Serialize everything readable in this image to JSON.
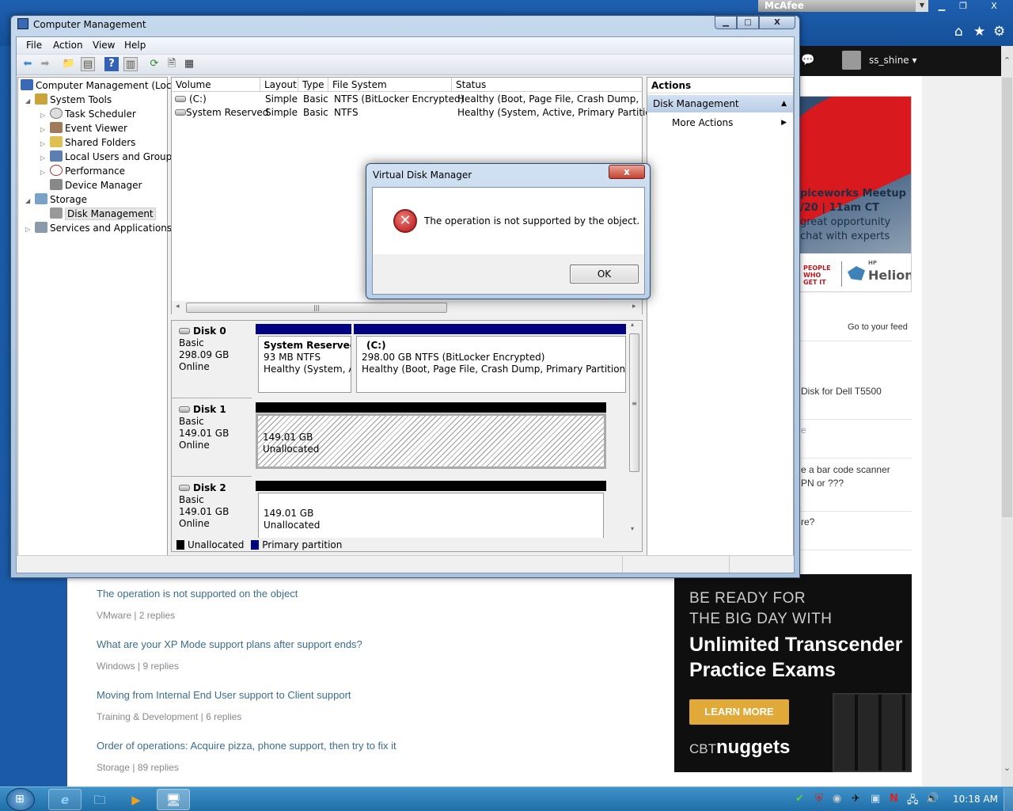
{
  "browser": {
    "security_addon": "McAfee",
    "nav_icons": [
      "home-icon",
      "star-icon",
      "gear-icon"
    ],
    "username": "ss_shine"
  },
  "site": {
    "ad1": {
      "lines": [
        "piceworks Meetup",
        "/20 | 11am CT",
        "great opportunity",
        "chat with experts"
      ],
      "logo_left": "PEOPLE WHO GET IT",
      "logo_right_small": "HP",
      "logo_right": "Helion"
    },
    "feed_link": "Go to your feed",
    "right_fragments": [
      "Disk for Dell T5500",
      "e",
      "e a bar code scanner",
      "PN or ???",
      "re?"
    ],
    "discussions": [
      {
        "title": "The operation is not supported on the object",
        "meta": "VMware | 2 replies"
      },
      {
        "title": "What are your XP Mode support plans after support ends?",
        "meta": "Windows | 9 replies"
      },
      {
        "title": "Moving from Internal End User support to Client support",
        "meta": "Training & Development | 6 replies"
      },
      {
        "title": "Order of operations: Acquire pizza, phone support, then try to fix it",
        "meta": "Storage | 89 replies"
      }
    ],
    "ad2": {
      "line1": "BE READY FOR",
      "line2": "THE BIG DAY WITH",
      "headline1": "Unlimited Transcender",
      "headline2": "Practice Exams",
      "cta": "LEARN MORE",
      "brand_prefix": "CBT",
      "brand": "nuggets",
      "accent": "#e1aa38"
    }
  },
  "window": {
    "title": "Computer Management",
    "menu": [
      "File",
      "Action",
      "View",
      "Help"
    ],
    "tree": [
      {
        "label": "Computer Management (Local",
        "level": 0
      },
      {
        "label": "System Tools",
        "level": 1,
        "expanded": true
      },
      {
        "label": "Task Scheduler",
        "level": 2
      },
      {
        "label": "Event Viewer",
        "level": 2
      },
      {
        "label": "Shared Folders",
        "level": 2
      },
      {
        "label": "Local Users and Groups",
        "level": 2
      },
      {
        "label": "Performance",
        "level": 2
      },
      {
        "label": "Device Manager",
        "level": 2
      },
      {
        "label": "Storage",
        "level": 1,
        "expanded": true
      },
      {
        "label": "Disk Management",
        "level": 2,
        "selected": true
      },
      {
        "label": "Services and Applications",
        "level": 1
      }
    ],
    "volume_columns": [
      "Volume",
      "Layout",
      "Type",
      "File System",
      "Status"
    ],
    "volumes": [
      {
        "volume": "(C:)",
        "layout": "Simple",
        "type": "Basic",
        "fs": "NTFS (BitLocker Encrypted)",
        "status": "Healthy (Boot, Page File, Crash Dump, Prima"
      },
      {
        "volume": "System Reserved",
        "layout": "Simple",
        "type": "Basic",
        "fs": "NTFS",
        "status": "Healthy (System, Active, Primary Partition)"
      }
    ],
    "disks": [
      {
        "name": "Disk 0",
        "type": "Basic",
        "size": "298.09 GB",
        "state": "Online",
        "partitions": [
          {
            "title": "System Reserved",
            "line1": "93 MB NTFS",
            "line2": "Healthy (System, Act"
          },
          {
            "title": "(C:)",
            "line1": "298.00 GB NTFS (BitLocker Encrypted)",
            "line2": "Healthy (Boot, Page File, Crash Dump, Primary Partition)"
          }
        ]
      },
      {
        "name": "Disk 1",
        "type": "Basic",
        "size": "149.01 GB",
        "state": "Online",
        "partitions": [
          {
            "line1": "149.01 GB",
            "line2": "Unallocated"
          }
        ]
      },
      {
        "name": "Disk 2",
        "type": "Basic",
        "size": "149.01 GB",
        "state": "Online",
        "partitions": [
          {
            "line1": "149.01 GB",
            "line2": "Unallocated"
          }
        ]
      }
    ],
    "legend": [
      {
        "label": "Unallocated",
        "color": "#000000"
      },
      {
        "label": "Primary partition",
        "color": "#000080"
      }
    ],
    "actions": {
      "header": "Actions",
      "section": "Disk Management",
      "more": "More Actions"
    }
  },
  "dialog": {
    "title": "Virtual Disk Manager",
    "close": "x",
    "message": "The operation is not supported by the object.",
    "ok": "OK"
  },
  "taskbar": {
    "pinned": [
      "internet-explorer",
      "windows-explorer",
      "media-player",
      "computer-management"
    ],
    "clock": "10:18 AM"
  }
}
